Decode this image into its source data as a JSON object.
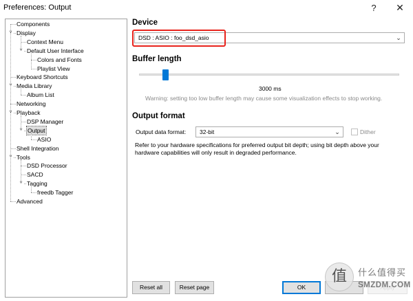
{
  "window": {
    "title": "Preferences: Output",
    "help_label": "?",
    "close_label": "✕"
  },
  "tree": {
    "items": [
      {
        "label": "Components",
        "level": 0,
        "toggle": ""
      },
      {
        "label": "Display",
        "level": 0,
        "toggle": "v"
      },
      {
        "label": "Context Menu",
        "level": 1,
        "toggle": ""
      },
      {
        "label": "Default User Interface",
        "level": 1,
        "toggle": "v"
      },
      {
        "label": "Colors and Fonts",
        "level": 2,
        "toggle": ""
      },
      {
        "label": "Playlist View",
        "level": 2,
        "toggle": ""
      },
      {
        "label": "Keyboard Shortcuts",
        "level": 0,
        "toggle": ""
      },
      {
        "label": "Media Library",
        "level": 0,
        "toggle": "v"
      },
      {
        "label": "Album List",
        "level": 1,
        "toggle": ""
      },
      {
        "label": "Networking",
        "level": 0,
        "toggle": ""
      },
      {
        "label": "Playback",
        "level": 0,
        "toggle": "v"
      },
      {
        "label": "DSP Manager",
        "level": 1,
        "toggle": ""
      },
      {
        "label": "Output",
        "level": 1,
        "toggle": "v",
        "selected": true
      },
      {
        "label": "ASIO",
        "level": 2,
        "toggle": ""
      },
      {
        "label": "Shell Integration",
        "level": 0,
        "toggle": ""
      },
      {
        "label": "Tools",
        "level": 0,
        "toggle": "v"
      },
      {
        "label": "DSD Processor",
        "level": 1,
        "toggle": ""
      },
      {
        "label": "SACD",
        "level": 1,
        "toggle": ""
      },
      {
        "label": "Tagging",
        "level": 1,
        "toggle": "v"
      },
      {
        "label": "freedb Tagger",
        "level": 2,
        "toggle": ""
      },
      {
        "label": "Advanced",
        "level": 0,
        "toggle": ""
      }
    ]
  },
  "device": {
    "section_title": "Device",
    "selected_value": "DSD : ASIO : foo_dsd_asio"
  },
  "buffer": {
    "section_title": "Buffer length",
    "value_label": "3000 ms",
    "position_fraction": 0.1,
    "warning": "Warning: setting too low buffer length may cause some visualization effects to stop working."
  },
  "output_format": {
    "section_title": "Output format",
    "data_format_label": "Output data format:",
    "data_format_value": "32-bit",
    "dither_label": "Dither",
    "dither_checked": false,
    "info_line1": "Refer to your hardware specifications for preferred output bit depth; using bit depth above your",
    "info_line2": "hardware capabilities will only result in degraded performance."
  },
  "buttons": {
    "reset_all": "Reset all",
    "reset_page": "Reset page",
    "ok": "OK",
    "cancel": "",
    "apply": "Apply"
  },
  "watermark": {
    "glyph": "值",
    "cn_text": "什么值得买",
    "en_text": "SMZDM.COM"
  },
  "colors": {
    "accent": "#0078d7",
    "highlight_box": "#e8221b"
  }
}
